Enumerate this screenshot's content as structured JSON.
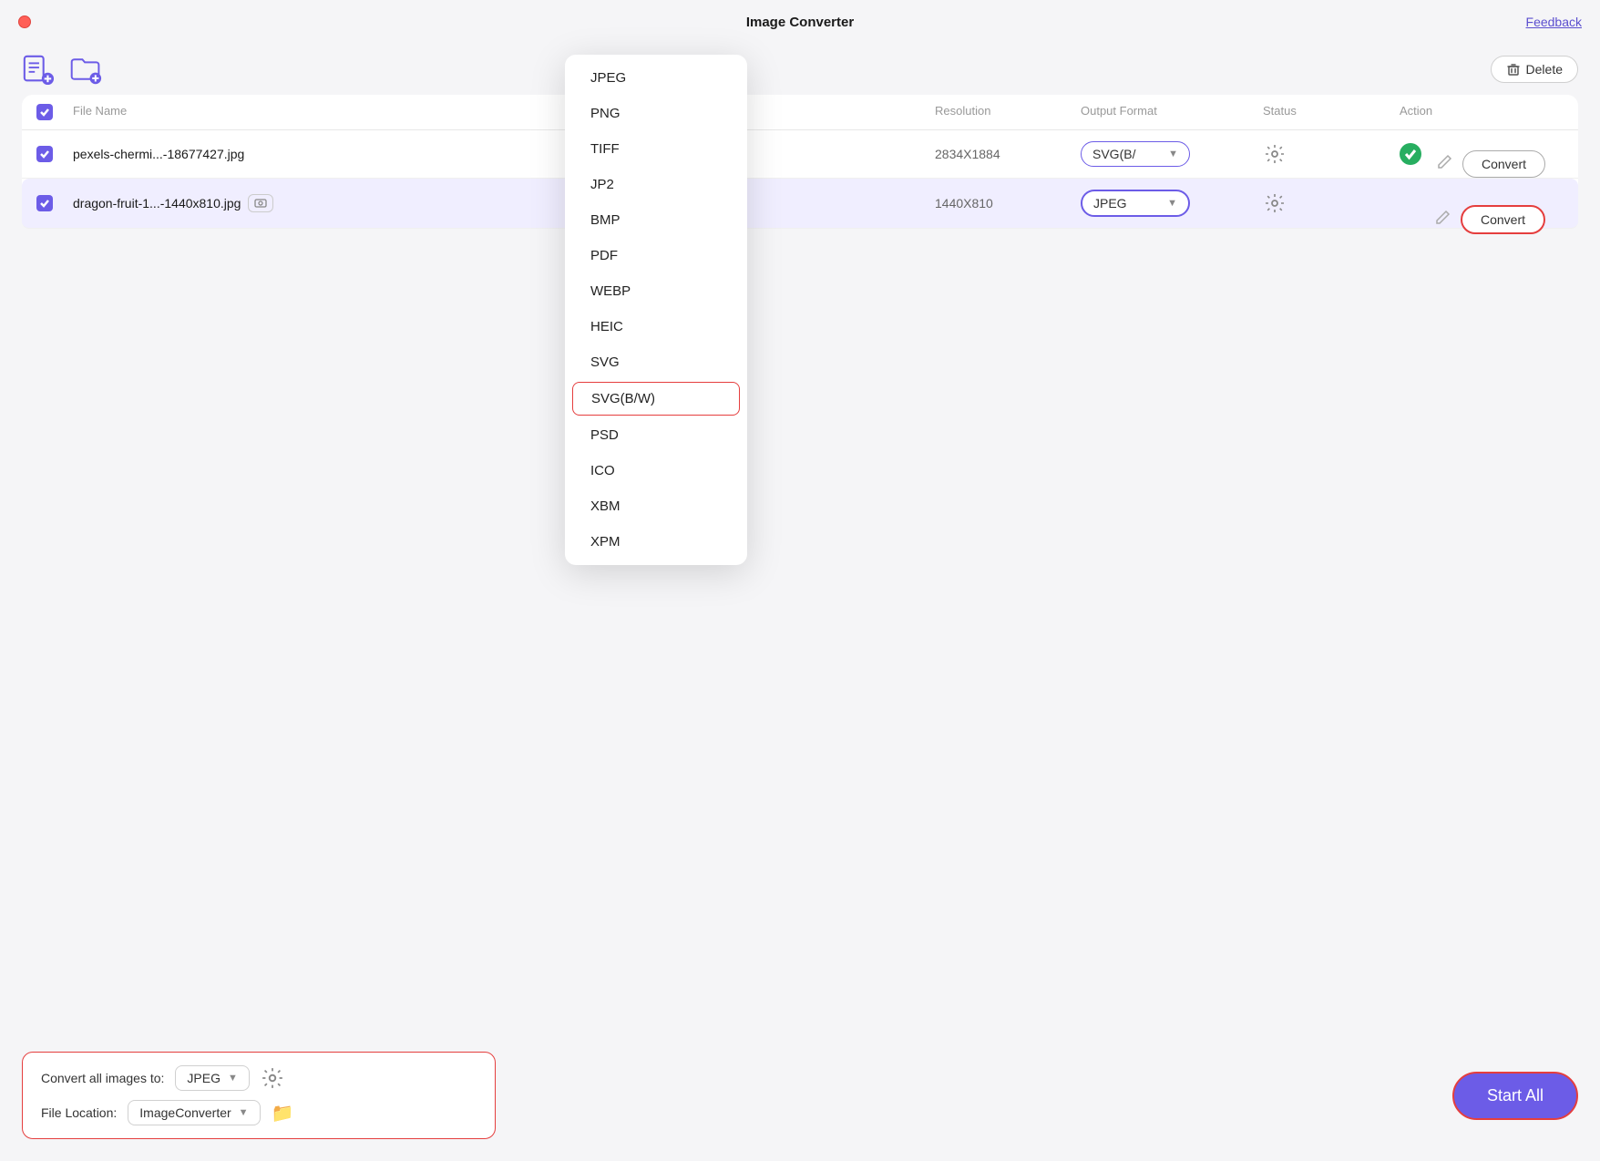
{
  "app": {
    "title": "Image Converter",
    "feedback_label": "Feedback"
  },
  "toolbar": {
    "delete_label": "Delete",
    "add_file_icon": "add-file-icon",
    "add_folder_icon": "add-folder-icon"
  },
  "table": {
    "columns": [
      "",
      "File Name",
      "Resolution",
      "Output Format",
      "Status",
      "Action"
    ],
    "rows": [
      {
        "id": "row1",
        "checked": true,
        "filename": "pexels-chermi...-18677427.jpg",
        "resolution": "2834X1884",
        "format": "SVG(B/",
        "status": "ok",
        "convert_label": "Convert"
      },
      {
        "id": "row2",
        "checked": true,
        "filename": "dragon-fruit-1...-1440x810.jpg",
        "resolution": "1440X810",
        "format": "JPEG",
        "status": "",
        "convert_label": "Convert",
        "highlighted": true
      }
    ]
  },
  "dropdown": {
    "items": [
      {
        "label": "JPEG",
        "selected": false
      },
      {
        "label": "PNG",
        "selected": false
      },
      {
        "label": "TIFF",
        "selected": false
      },
      {
        "label": "JP2",
        "selected": false
      },
      {
        "label": "BMP",
        "selected": false
      },
      {
        "label": "PDF",
        "selected": false
      },
      {
        "label": "WEBP",
        "selected": false
      },
      {
        "label": "HEIC",
        "selected": false
      },
      {
        "label": "SVG",
        "selected": false
      },
      {
        "label": "SVG(B/W)",
        "selected": true
      },
      {
        "label": "PSD",
        "selected": false
      },
      {
        "label": "ICO",
        "selected": false
      },
      {
        "label": "XBM",
        "selected": false
      },
      {
        "label": "XPM",
        "selected": false
      }
    ]
  },
  "bottom": {
    "convert_all_label": "Convert all images to:",
    "format_value": "JPEG",
    "file_location_label": "File Location:",
    "location_value": "ImageConverter",
    "start_all_label": "Start  All"
  }
}
